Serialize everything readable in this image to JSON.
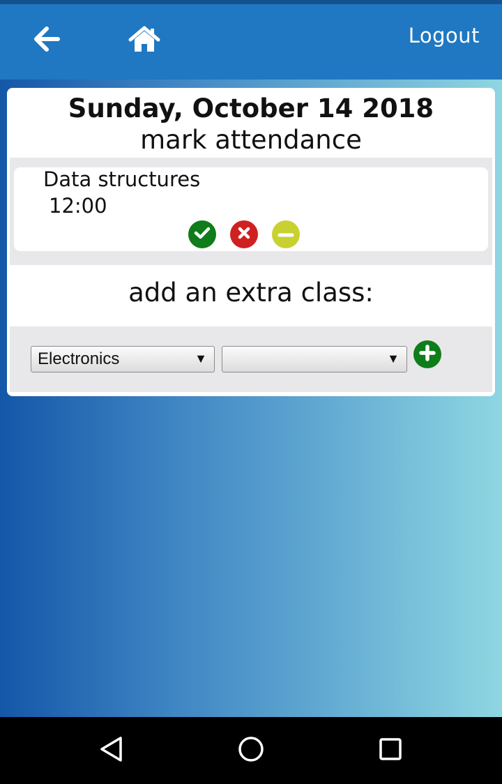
{
  "header": {
    "back_icon": "arrow-left-icon",
    "home_icon": "home-icon",
    "logout_label": "Logout",
    "bar_color": "#1f78c1"
  },
  "attendance": {
    "date": "Sunday, October 14 2018",
    "subtitle": "mark attendance",
    "classes": [
      {
        "name": "Data structures",
        "time": "12:00",
        "actions": [
          {
            "icon": "check-circle-icon",
            "color": "#0f7d1a"
          },
          {
            "icon": "x-circle-icon",
            "color": "#d02121"
          },
          {
            "icon": "minus-circle-icon",
            "color": "#c9d130"
          }
        ]
      }
    ]
  },
  "extra_class": {
    "title": "add an extra class:",
    "subject_select": {
      "selected": "Electronics"
    },
    "time_select": {
      "selected": ""
    },
    "add_icon": "plus-circle-icon"
  },
  "system_nav": {
    "back_icon": "triangle-back-icon",
    "home_icon": "circle-home-icon",
    "recent_icon": "square-recent-icon"
  }
}
